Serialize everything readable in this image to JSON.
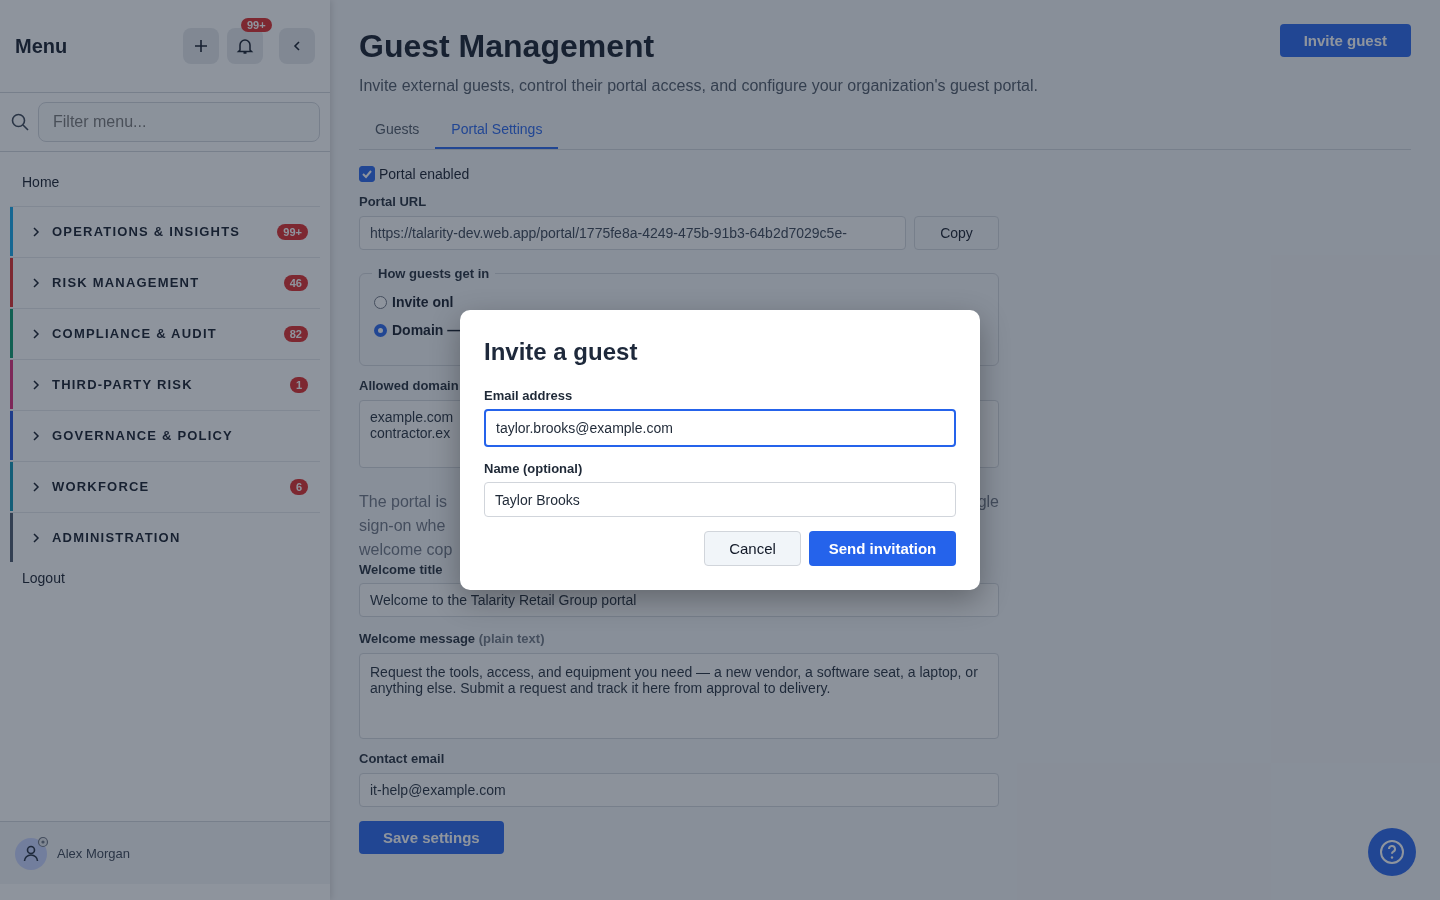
{
  "sidebar": {
    "title": "Menu",
    "notification_badge": "99+",
    "filter": {
      "placeholder": "Filter menu..."
    },
    "home": "Home",
    "groups": [
      {
        "label": "OPERATIONS & INSIGHTS",
        "color": "#166792",
        "badge": "99+"
      },
      {
        "label": "RISK MANAGEMENT",
        "color": "#7d2831",
        "badge": "46"
      },
      {
        "label": "COMPLIANCE & AUDIT",
        "color": "#126052",
        "badge": "82"
      },
      {
        "label": "THIRD-PARTY RISK",
        "color": "#7d2859",
        "badge": "1"
      },
      {
        "label": "GOVERNANCE & POLICY",
        "color": "#1e3c8a"
      },
      {
        "label": "WORKFORCE",
        "color": "#135d77",
        "badge": "6"
      },
      {
        "label": "ADMINISTRATION",
        "color": "#333f52"
      }
    ],
    "logout": "Logout",
    "user": "Alex Morgan"
  },
  "page": {
    "title": "Guest Management",
    "subtitle": "Invite external guests, control their portal access, and configure your organization's guest portal.",
    "invite_button": "Invite guest",
    "tabs": [
      {
        "label": "Guests",
        "selected": false
      },
      {
        "label": "Portal Settings",
        "selected": true
      }
    ],
    "portal_enabled": {
      "label": "Portal enabled",
      "checked": true
    },
    "portal_url": {
      "label": "Portal URL",
      "value": "https://talarity-dev.web.app/portal/1775fe8a-4249-475b-91b3-64b2d7029c5e-"
    },
    "copy_button": "Copy",
    "access": {
      "legend": "How guests get in",
      "options": [
        {
          "label": "Invite onl",
          "selected": false
        },
        {
          "label": "Domain —",
          "selected": true
        }
      ]
    },
    "allowed_domains": {
      "label": "Allowed domain",
      "value": "example.com\ncontractor.ex"
    },
    "description": {
      "lines": [
        "The portal is",
        "sign-on whe",
        "welcome cop"
      ],
      "tail": "gle"
    },
    "welcome_title": {
      "label": "Welcome title",
      "value": "Welcome to the Talarity Retail Group portal"
    },
    "welcome_message": {
      "label": "Welcome message",
      "hint": "(plain text)",
      "value": "Request the tools, access, and equipment you need — a new vendor, a software seat, a laptop, or anything else. Submit a request and track it here from approval to delivery."
    },
    "contact_email": {
      "label": "Contact email",
      "value": "it-help@example.com"
    },
    "save_button": "Save settings"
  },
  "dialog": {
    "title": "Invite a guest",
    "fields": [
      {
        "label": "Email address",
        "value": "taylor.brooks@example.com",
        "focused": true
      },
      {
        "label": "Name (optional)",
        "value": "Taylor Brooks",
        "focused": false
      }
    ],
    "buttons": [
      {
        "label": "Cancel",
        "kind": "secondary"
      },
      {
        "label": "Send invitation",
        "kind": "primary"
      }
    ]
  }
}
